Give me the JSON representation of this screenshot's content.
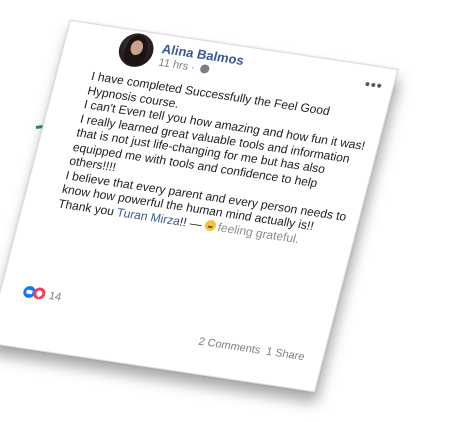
{
  "post": {
    "author": "Alina Balmos",
    "time": "11 hrs",
    "separator": "·",
    "more_glyph": "•••",
    "paragraphs": [
      "I have completed Successfully the Feel Good Hypnosis course.",
      "I can't Even tell you how amazing and how fun it was! I really learned great valuable tools and information that is not just life-changing for me but has also equipped me with tools and confidence to help others!!!!",
      "I believe that every parent and every person needs to know how powerful the human mind actually is!!"
    ],
    "thanks_prefix": "Thank you ",
    "mention": "Turan Mirza",
    "thanks_suffix": "!! — ",
    "feeling": "feeling grateful.",
    "reaction_count": "14",
    "comments": "2 Comments",
    "shares": "1 Share"
  },
  "colors": {
    "link_blue": "#385898",
    "frame_green": "#2f8a5e",
    "like_blue": "#1877f2",
    "love_red": "#f33e58"
  },
  "icons": [
    "globe-icon",
    "more-options-icon",
    "grateful-emoji-icon",
    "like-reaction-icon",
    "love-reaction-icon"
  ]
}
